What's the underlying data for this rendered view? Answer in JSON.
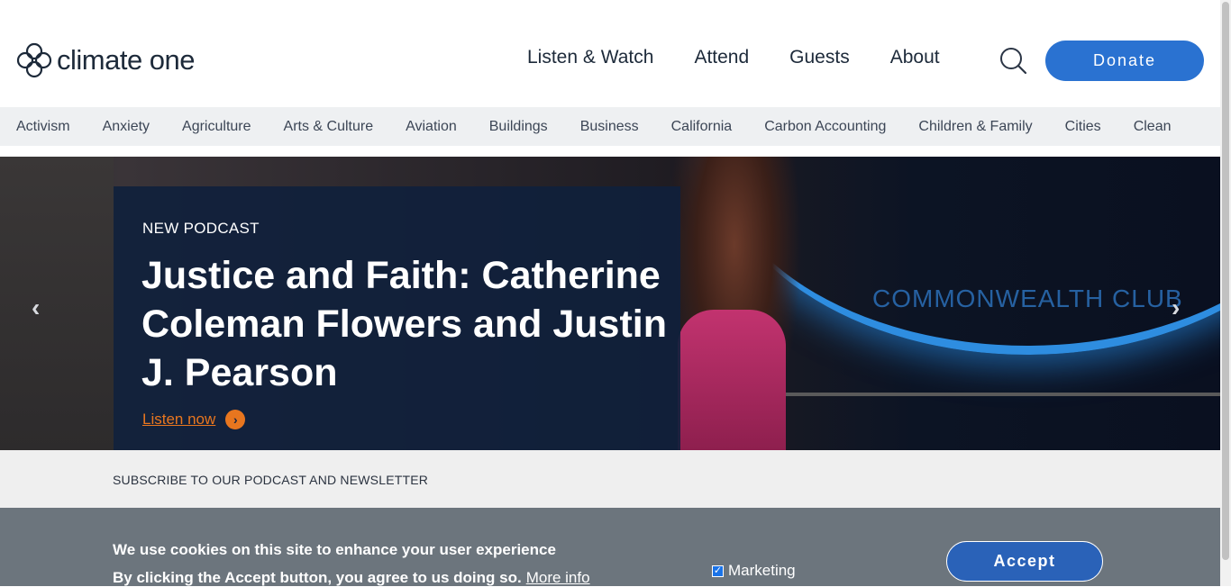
{
  "header": {
    "logo_text": "climate one",
    "nav": [
      "Listen & Watch",
      "Attend",
      "Guests",
      "About"
    ],
    "donate_label": "Donate"
  },
  "topics": [
    "Activism",
    "Anxiety",
    "Agriculture",
    "Arts & Culture",
    "Aviation",
    "Buildings",
    "Business",
    "California",
    "Carbon Accounting",
    "Children & Family",
    "Cities",
    "Clean"
  ],
  "hero": {
    "kicker": "NEW PODCAST",
    "title": "Justice and Faith: Catherine Coleman Flowers and Justin J. Pearson",
    "cta_label": "Listen now",
    "background_text": "COMMONWEALTH CLUB",
    "prev_icon": "‹",
    "next_icon": "›"
  },
  "subscribe": {
    "label": "SUBSCRIBE TO OUR PODCAST AND NEWSLETTER"
  },
  "cookie": {
    "heading": "We use cookies on this site to enhance your user experience",
    "body": "By clicking the Accept button, you agree to us doing so.",
    "more_info": "More info",
    "marketing_label": "Marketing",
    "marketing_checked": true,
    "accept_label": "Accept"
  },
  "colors": {
    "brand_blue": "#2a72d1",
    "accent_orange": "#e8761f",
    "hero_card": "#10203c",
    "cookie_bg": "#6c757d"
  }
}
